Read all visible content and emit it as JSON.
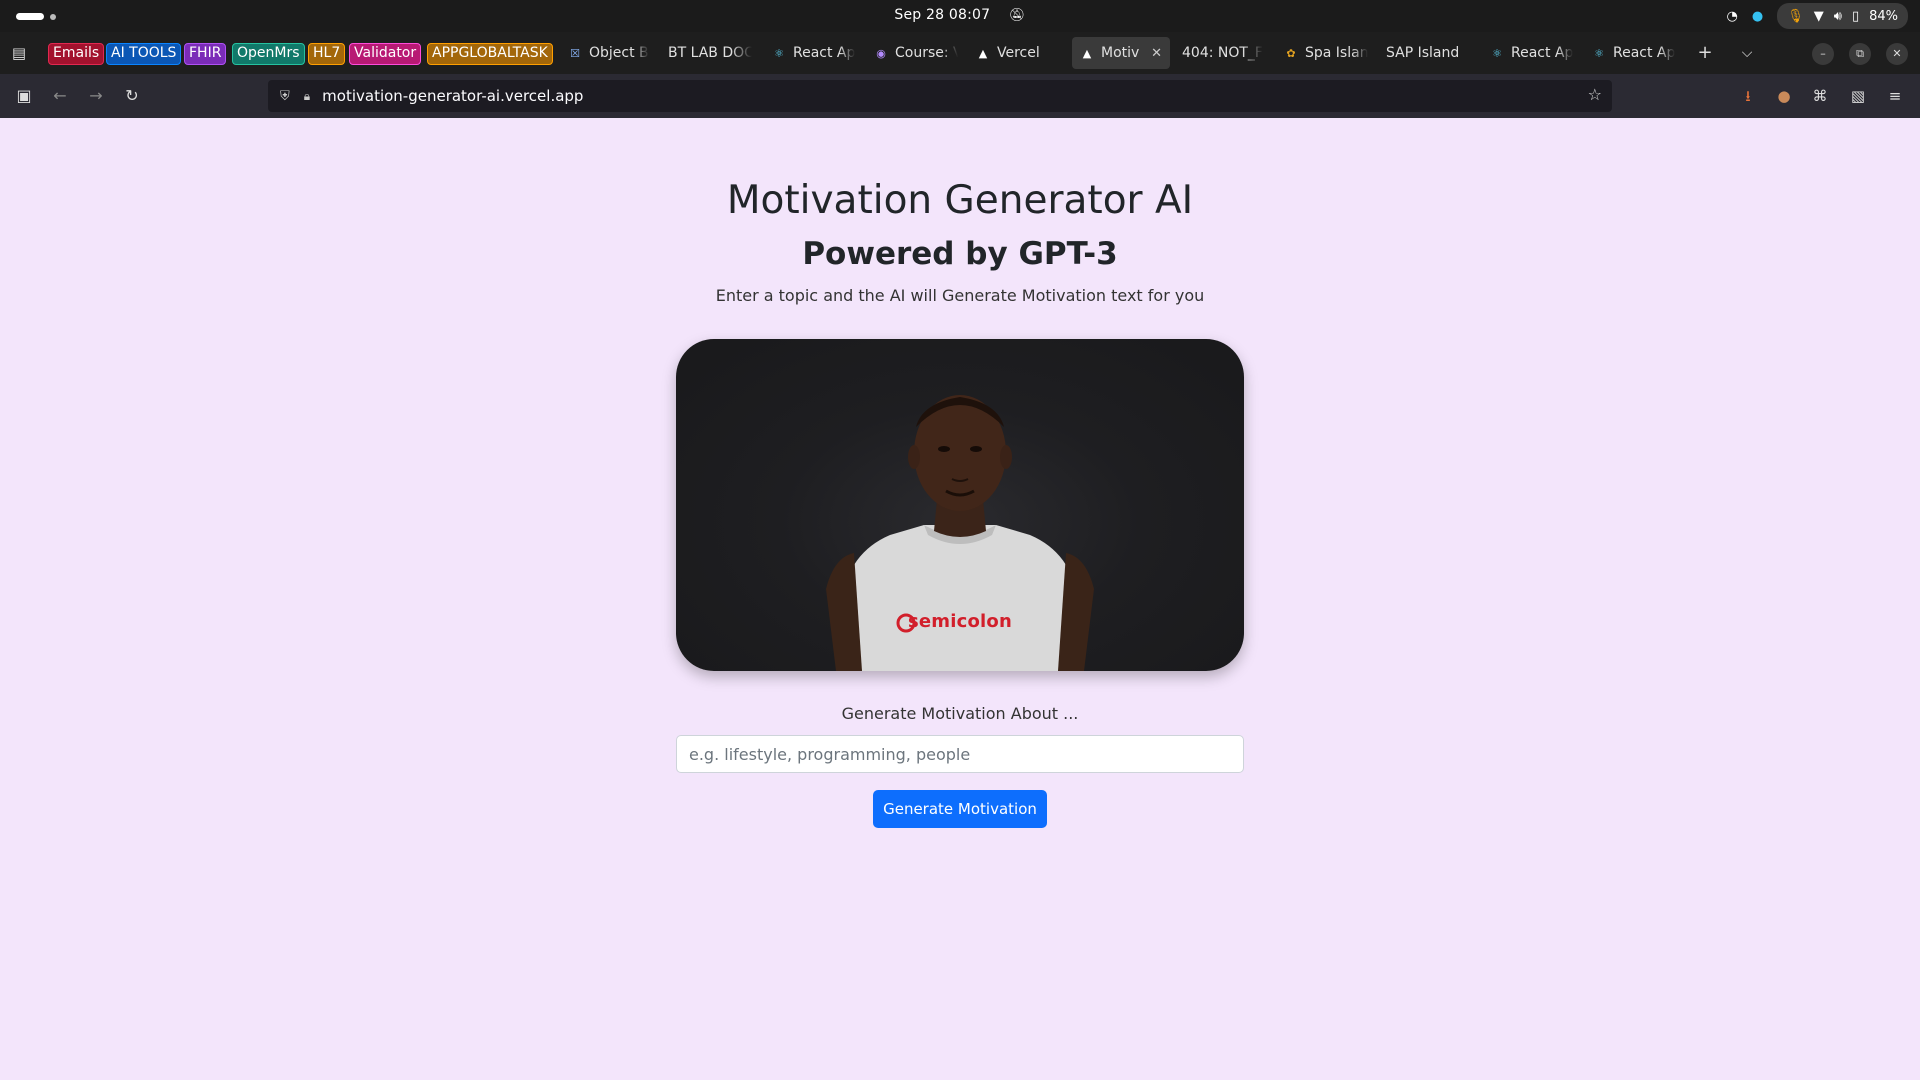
{
  "system_bar": {
    "clock": "Sep 28  08:07",
    "battery": "84%"
  },
  "tab_groups": [
    {
      "label": "Emails",
      "color": "#e22850"
    },
    {
      "label": "AI TOOLS",
      "color": "#0a84ff"
    },
    {
      "label": "FHIR",
      "color": "#af51f5"
    },
    {
      "label": "OpenMrs",
      "color": "#25c2a0"
    },
    {
      "label": "HL7",
      "color": "#ff9f00"
    },
    {
      "label": "Validator",
      "color": "#ff4bda"
    },
    {
      "label": "APPGLOBALTASK",
      "color": "#ff9f00"
    }
  ],
  "tabs": [
    {
      "label": "Object B",
      "icon": "figma-like-icon"
    },
    {
      "label": "BT LAB DOC",
      "icon": "none"
    },
    {
      "label": "React Ap",
      "icon": "react-icon"
    },
    {
      "label": "Course: V",
      "icon": "shield-icon"
    },
    {
      "label": "Vercel",
      "icon": "vercel-icon"
    },
    {
      "label": "Motiva",
      "icon": "vercel-icon",
      "active": true
    },
    {
      "label": "404: NOT_F",
      "icon": "none"
    },
    {
      "label": "Spa Islan",
      "icon": "spa-icon"
    },
    {
      "label": "SAP Island",
      "icon": "none"
    },
    {
      "label": "React Ap",
      "icon": "react-icon"
    },
    {
      "label": "React Ap",
      "icon": "react-icon"
    }
  ],
  "address_bar": {
    "url": "motivation-generator-ai.vercel.app"
  },
  "page": {
    "title": "Motivation Generator AI",
    "subtitle": "Powered by GPT-3",
    "description": "Enter a topic and the AI will Generate Motivation text for you",
    "hero_shirt_text": "semicolon",
    "form_label": "Generate Motivation About ...",
    "input_placeholder": "e.g. lifestyle, programming, people",
    "input_value": "",
    "button_label": "Generate Motivation"
  },
  "colors": {
    "page_background": "#f3e5fb",
    "button_primary": "#0d6efd",
    "shirt_logo": "#d21f2b"
  }
}
